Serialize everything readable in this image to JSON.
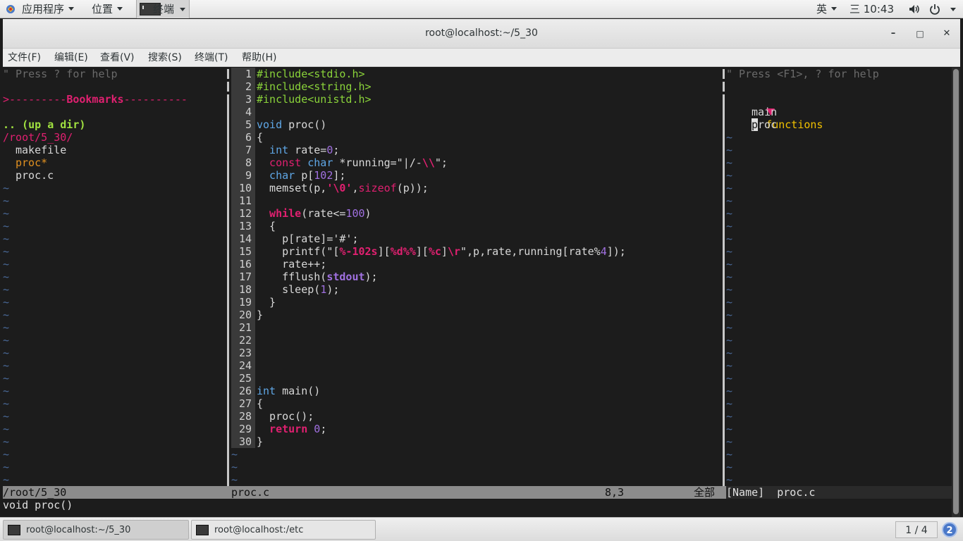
{
  "top_panel": {
    "apps_label": "应用程序",
    "places_label": "位置",
    "terminal_task_label": "终端",
    "input_method": "英",
    "clock": "三 10:43"
  },
  "window": {
    "title": "root@localhost:~/5_30",
    "minimize": "–",
    "maximize": "□",
    "close": "✕"
  },
  "menubar": {
    "file": "文件(F)",
    "edit": "编辑(E)",
    "view": "查看(V)",
    "search": "搜索(S)",
    "terminal": "终端(T)",
    "help": "帮助(H)"
  },
  "nerdtree": {
    "help_hint": "\" Press ? for help",
    "bookmarks_prefix": ">---------",
    "bookmarks_label": "Bookmarks",
    "bookmarks_suffix": "----------",
    "up_dir": ".. (up a dir)",
    "cwd": "/root/5_30/",
    "files": [
      "makefile",
      "proc*",
      "proc.c"
    ]
  },
  "editor": {
    "line_numbers": [
      "1",
      "2",
      "3",
      "4",
      "5",
      "6",
      "7",
      "8",
      "9",
      "10",
      "11",
      "12",
      "13",
      "14",
      "15",
      "16",
      "17",
      "18",
      "19",
      "20",
      "21",
      "22",
      "23",
      "24",
      "25",
      "26",
      "27",
      "28",
      "29",
      "30"
    ],
    "code": {
      "l1_a": "#include",
      "l1_b": "<stdio.h>",
      "l2_a": "#include",
      "l2_b": "<string.h>",
      "l3_a": "#include",
      "l3_b": "<unistd.h>",
      "l5_a": "void",
      "l5_b": " proc()",
      "l6": "{",
      "l7_a": "  int",
      "l7_b": " rate=",
      "l7_c": "0",
      "l7_d": ";",
      "l8_a": "  const",
      "l8_b": " char",
      "l8_c": " *running=\"",
      "l8_d": "|/-",
      "l8_e": "\\\\",
      "l8_f": "\";",
      "l9_a": "  char",
      "l9_b": " p[",
      "l9_c": "102",
      "l9_d": "];",
      "l10_a": "  memset(p,",
      "l10_b": "'\\0'",
      "l10_c": ",",
      "l10_d": "sizeof",
      "l10_e": "(p));",
      "l12_a": "  while",
      "l12_b": "(rate<=",
      "l12_c": "100",
      "l12_d": ")",
      "l13": "  {",
      "l14": "    p[rate]='#';",
      "l15_a": "    printf(\"[",
      "l15_b": "%-102s",
      "l15_c": "][",
      "l15_d": "%d%%",
      "l15_e": "][",
      "l15_f": "%c",
      "l15_g": "]",
      "l15_h": "\\r",
      "l15_i": "\",p,rate,running[rate%",
      "l15_j": "4",
      "l15_k": "]);",
      "l16": "    rate++;",
      "l17_a": "    fflush(",
      "l17_b": "stdout",
      "l17_c": ");",
      "l18_a": "    sleep(",
      "l18_b": "1",
      "l18_c": ");",
      "l19": "  }",
      "l20": "}",
      "l26_a": "int",
      "l26_b": " main()",
      "l27": "{",
      "l28": "  proc();",
      "l29_a": "  return",
      "l29_b": " 0",
      "l29_c": ";",
      "l30": "}"
    }
  },
  "taglist": {
    "help_hint": "\" Press <F1>, ? for help",
    "group": "functions",
    "items": [
      "main",
      "proc"
    ]
  },
  "statusline": {
    "nerd_path": "/root/5_30",
    "file": "proc.c",
    "position": "8,3",
    "scroll": "全部",
    "tag_name": "[Name]",
    "tag_file": "proc.c"
  },
  "cmdline": "void proc()",
  "taskbar": {
    "task1": "root@localhost:~/5_30",
    "task2": "root@localhost:/etc",
    "workspace": "1 / 4",
    "notifications": "2"
  },
  "colors": {
    "preproc": "#8ad33a",
    "type": "#5fa7e6",
    "keyword": "#e02070",
    "number": "#a070e0",
    "tilde": "#4a6a9a"
  }
}
